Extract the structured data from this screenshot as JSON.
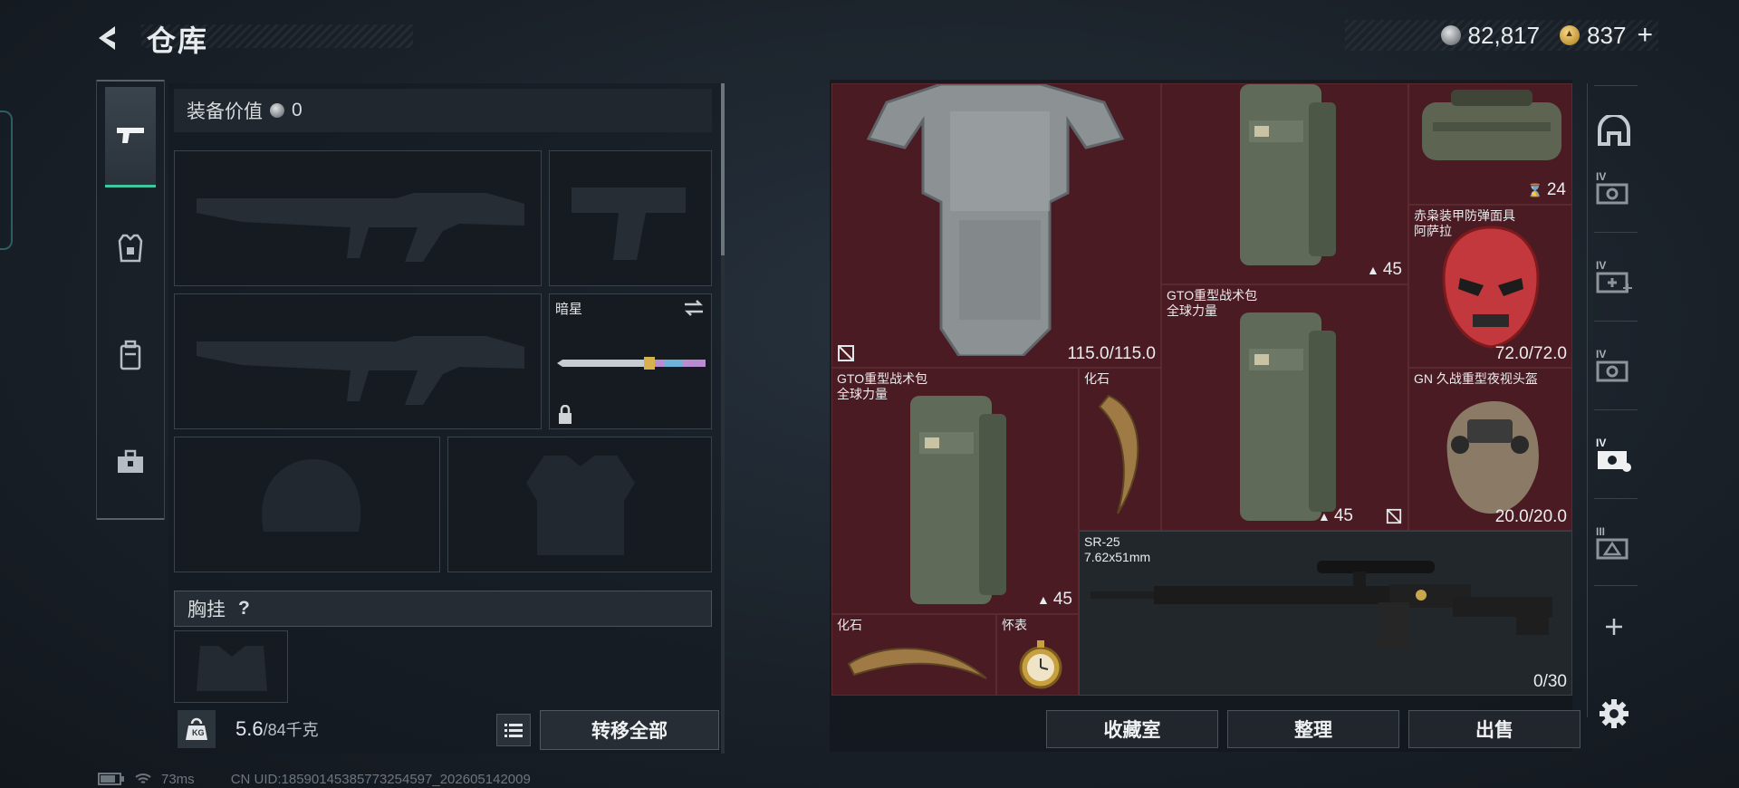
{
  "header": {
    "title": "仓库",
    "currencies": [
      {
        "icon": "silver-coin-icon",
        "value": "82,817"
      },
      {
        "icon": "gold-coin-icon",
        "value": "837"
      }
    ],
    "add_symbol": "+"
  },
  "left_rail": {
    "tabs": [
      {
        "icon": "pistol-icon",
        "active": true
      },
      {
        "icon": "armor-vest-icon",
        "active": false
      },
      {
        "icon": "backpack-icon",
        "active": false
      },
      {
        "icon": "toolbox-icon",
        "active": false
      }
    ]
  },
  "loadout": {
    "equip_value_label": "装备价值",
    "equip_value": "0",
    "melee_name": "暗星",
    "chest_rig_label": "胸挂",
    "chest_rig_help": "?",
    "weight_value": "5.6",
    "weight_capacity": "/84千克",
    "weight_icon_text": "KG",
    "transfer_all": "转移全部"
  },
  "storage": {
    "items": [
      {
        "name": "",
        "value": "115.0/115.0",
        "icon": "body-armor-icon"
      },
      {
        "name": "",
        "value": "45",
        "icon": "tactical-backpack-icon"
      },
      {
        "name": "",
        "value": "24",
        "icon": "duffel-bag-icon"
      },
      {
        "name": "赤枭装甲防弹面具\n阿萨拉",
        "value": "72.0/72.0",
        "icon": "red-mask-icon"
      },
      {
        "name": "GTO重型战术包\n全球力量",
        "value": "45",
        "icon": "tactical-backpack-icon"
      },
      {
        "name": "GTO重型战术包\n全球力量",
        "value": "45",
        "icon": "tactical-backpack-icon"
      },
      {
        "name": "化石",
        "value": "",
        "icon": "fossil-claw-icon"
      },
      {
        "name": "GN 久战重型夜视头盔",
        "value": "20.0/20.0",
        "icon": "night-vision-helmet-icon"
      },
      {
        "name": "SR-25\n7.62x51mm",
        "value": "0/30",
        "icon": "sniper-rifle-icon"
      },
      {
        "name": "化石",
        "value": "",
        "icon": "fossil-claw-icon"
      },
      {
        "name": "怀表",
        "value": "",
        "icon": "pocket-watch-icon"
      }
    ],
    "actions": [
      "收藏室",
      "整理",
      "出售"
    ]
  },
  "right_rail": {
    "tabs": [
      "storage-main-icon",
      "storage-tab-1-icon",
      "storage-tab-2-icon",
      "storage-tab-3-icon",
      "storage-tab-4-icon",
      "storage-tab-5-icon",
      "add-tab-icon",
      "settings-icon"
    ],
    "tier_labels": [
      "IV",
      "IV",
      "IV",
      "IV",
      "III"
    ]
  },
  "status": {
    "ping": "73ms",
    "uid": "CN UID:18590145385773254597_202605142009"
  }
}
